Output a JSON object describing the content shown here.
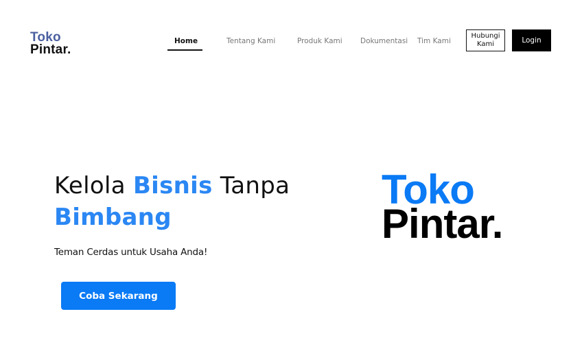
{
  "header": {
    "logo": {
      "line1": "Toko",
      "line2": "Pintar."
    },
    "nav": [
      {
        "label": "Home",
        "active": true
      },
      {
        "label": "Tentang Kami",
        "active": false
      },
      {
        "label": "Produk Kami",
        "active": false
      },
      {
        "label": "Dokumentasi",
        "active": false
      },
      {
        "label": "Tim Kami",
        "active": false
      }
    ],
    "contact_button": {
      "line1": "Hubungi",
      "line2": "Kami"
    },
    "login_button": "Login"
  },
  "hero": {
    "title_part1": "Kelola ",
    "title_accent1": "Bisnis",
    "title_part2": " Tanpa",
    "title_accent2": "Bimbang",
    "tagline": "Teman Cerdas untuk Usaha Anda!",
    "cta_label": "Coba Sekarang"
  },
  "brand_logo": {
    "line1": "Toko",
    "line2": "Pintar."
  },
  "colors": {
    "accent": "#0a7af5",
    "logo_small_top": "#4a5fa0",
    "text": "#111111"
  }
}
